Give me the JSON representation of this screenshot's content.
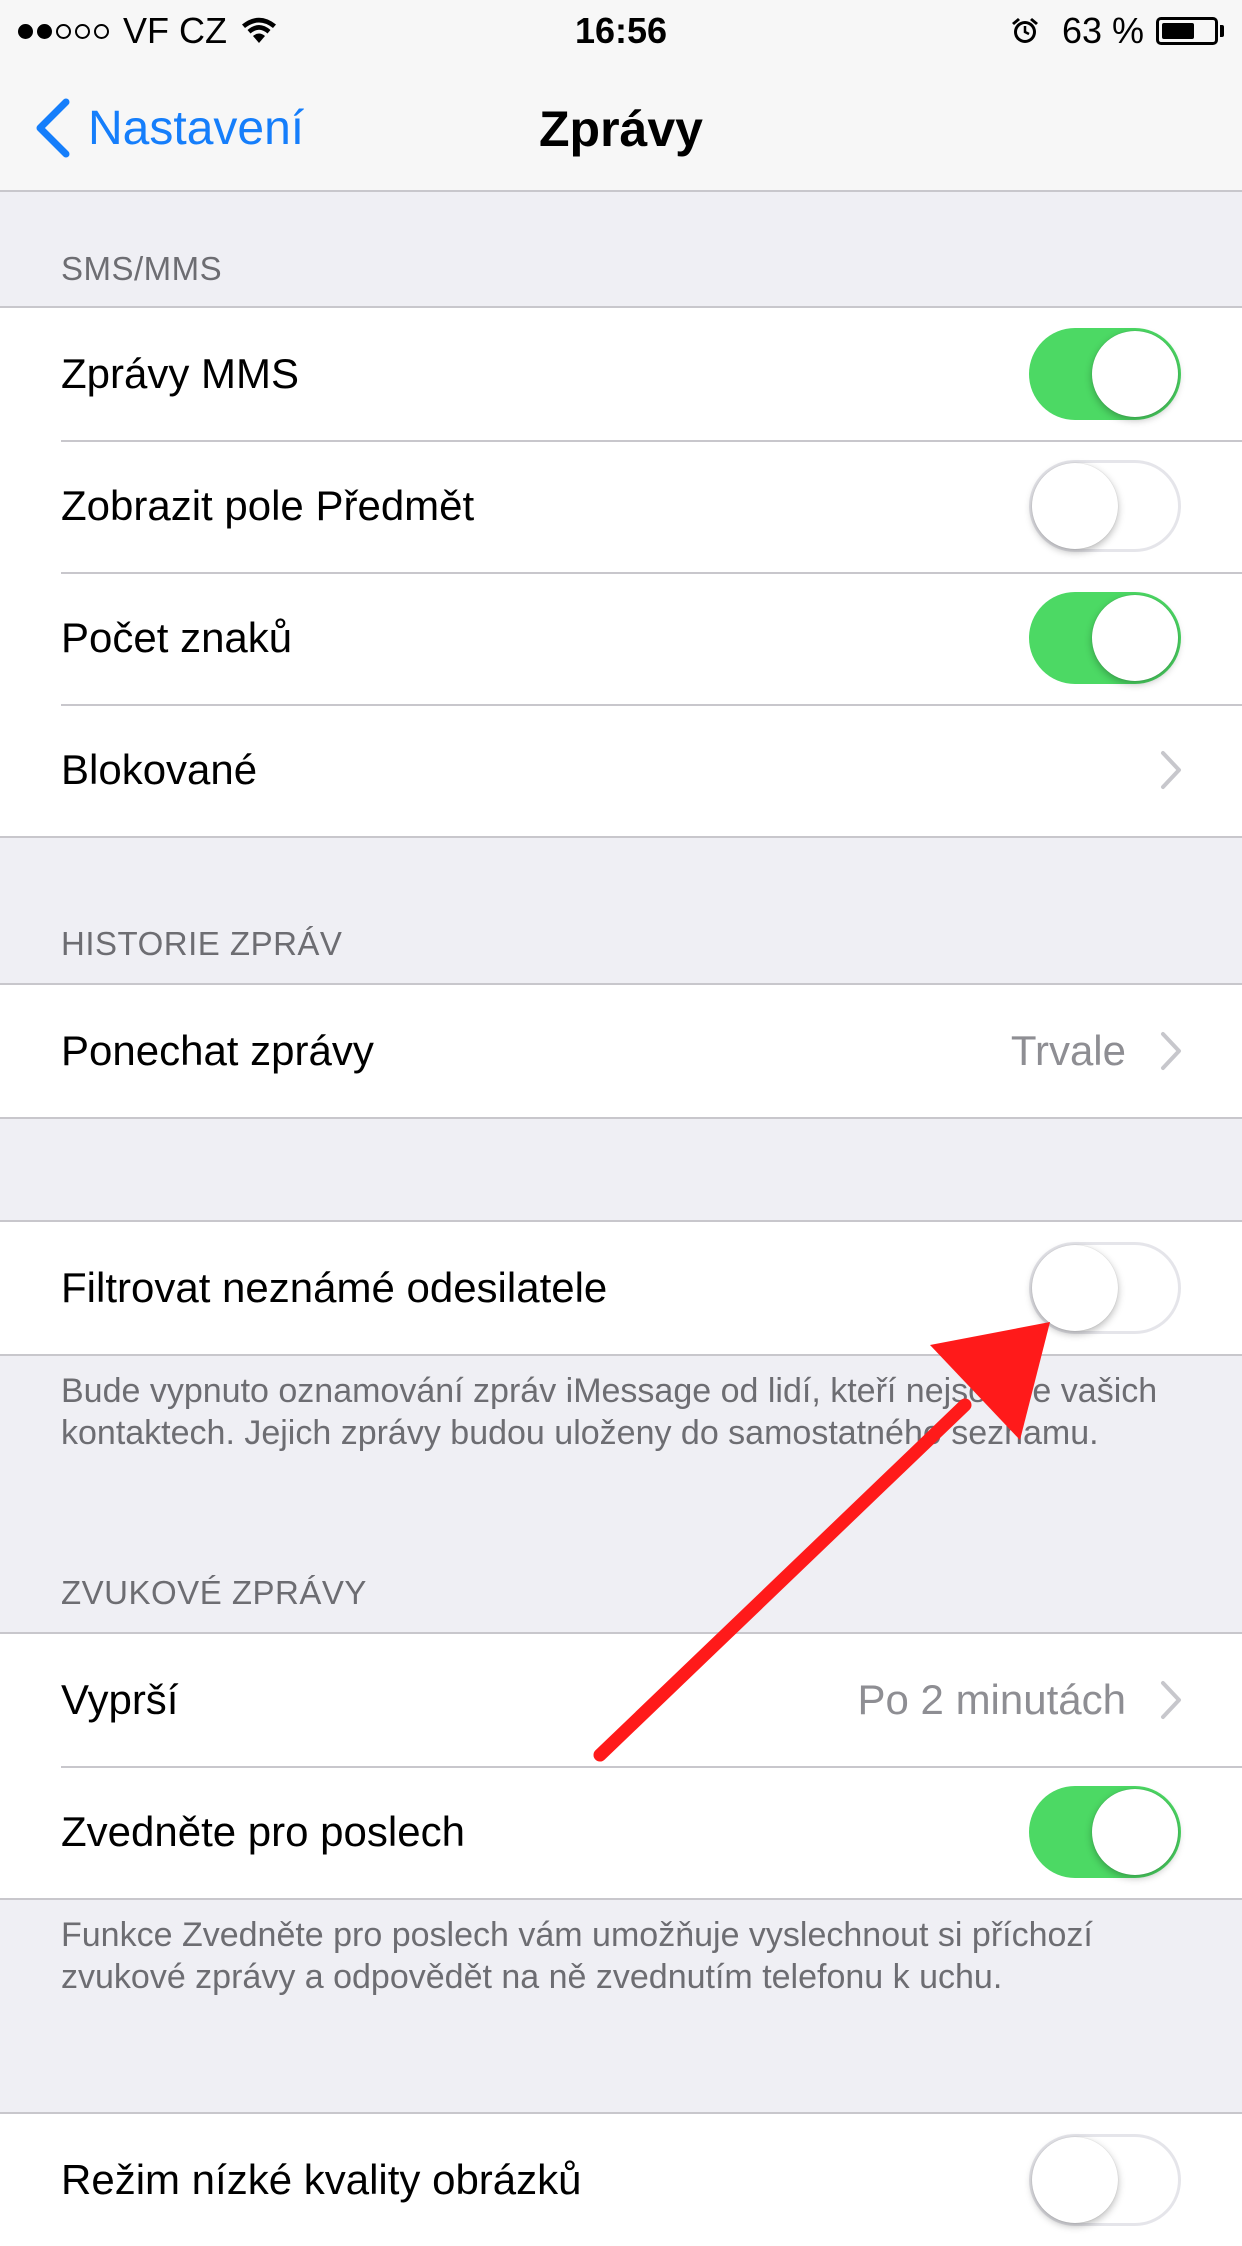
{
  "status_bar": {
    "carrier": "VF CZ",
    "time": "16:56",
    "battery_percent": "63 %",
    "battery_level": 0.63,
    "signal_bars_filled": 2,
    "signal_bars_total": 5
  },
  "nav": {
    "back_label": "Nastavení",
    "title": "Zprávy"
  },
  "sections": {
    "sms": {
      "header": "SMS/MMS",
      "rows": [
        {
          "label": "Zprávy MMS",
          "toggle": true
        },
        {
          "label": "Zobrazit pole Předmět",
          "toggle": false
        },
        {
          "label": "Počet znaků",
          "toggle": true
        },
        {
          "label": "Blokované"
        }
      ]
    },
    "history": {
      "header": "HISTORIE ZPRÁV",
      "rows": [
        {
          "label": "Ponechat zprávy",
          "value": "Trvale"
        }
      ]
    },
    "filter": {
      "rows": [
        {
          "label": "Filtrovat neznámé odesilatele",
          "toggle": false
        }
      ],
      "footer": "Bude vypnuto oznamování zpráv iMessage od lidí, kteří nejsou ve vašich kontaktech. Jejich zprávy budou uloženy do samostatného seznamu."
    },
    "audio": {
      "header": "ZVUKOVÉ ZPRÁVY",
      "rows": [
        {
          "label": "Vyprší",
          "value": "Po 2 minutách"
        },
        {
          "label": "Zvedněte pro poslech",
          "toggle": true
        }
      ],
      "footer": "Funkce Zvedněte pro poslech vám umožňuje vyslechnout si příchozí zvukové zprávy a odpovědět na ně zvednutím telefonu k uchu."
    },
    "image": {
      "rows": [
        {
          "label": "Režim nízké kvality obrázků",
          "toggle": false
        }
      ]
    }
  },
  "colors": {
    "accent": "#157efb",
    "toggle_on": "#4cd964",
    "annotation_arrow": "#ff1a1a"
  }
}
